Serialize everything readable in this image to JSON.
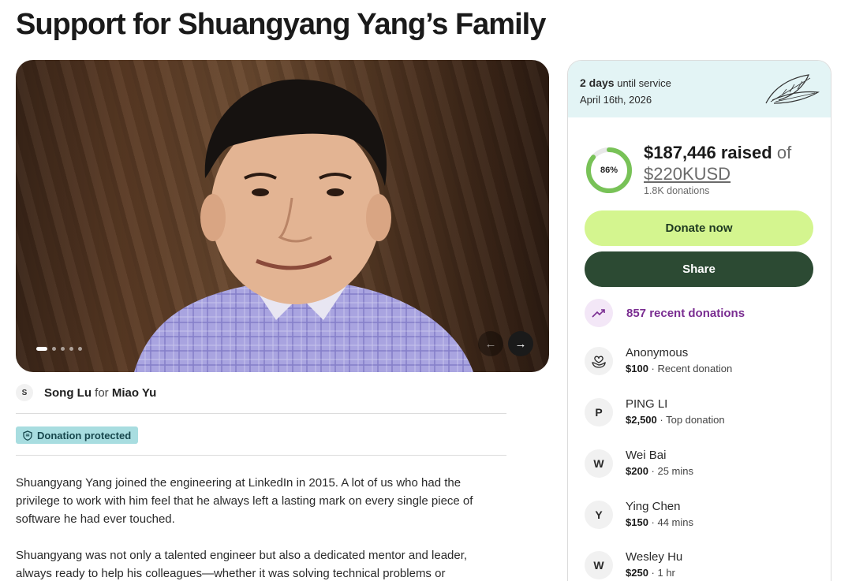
{
  "page": {
    "title": "Support for Shuangyang Yang’s Family"
  },
  "carousel": {
    "slide_count": 5,
    "active_index": 0,
    "prev_icon": "arrow-left-icon",
    "next_icon": "arrow-right-icon"
  },
  "organizer": {
    "initial": "S",
    "name": "Song Lu",
    "for_word": "for",
    "beneficiary": "Miao Yu"
  },
  "badge": {
    "label": "Donation protected",
    "icon": "shield-icon"
  },
  "story": {
    "paragraphs": [
      "Shuangyang Yang joined the engineering at LinkedIn in 2015. A lot of us who had the privilege to work with him feel that he always left a lasting mark on every single piece of software he had ever touched.",
      "Shuangyang was not only a talented engineer but also a dedicated mentor and leader, always ready to help his colleagues—whether it was solving technical problems or"
    ]
  },
  "sidebar": {
    "countdown": {
      "days": "2 days",
      "suffix": "until service",
      "date": "April 16th, 2026"
    },
    "progress": {
      "percent_label": "86%",
      "fraction": 0.86
    },
    "raised": {
      "amount": "$187,446 raised",
      "of": "of",
      "goal": "$220KUSD",
      "donations": "1.8K donations"
    },
    "donate_label": "Donate now",
    "share_label": "Share",
    "recent_label": "857 recent donations",
    "donors": [
      {
        "initial": "",
        "icon": "hand-heart-icon",
        "name": "Anonymous",
        "amount": "$100",
        "note": "· Recent donation"
      },
      {
        "initial": "P",
        "name": "PING LI",
        "amount": "$2,500",
        "note": "· Top donation"
      },
      {
        "initial": "W",
        "name": "Wei Bai",
        "amount": "$200",
        "note": "· 25 mins"
      },
      {
        "initial": "Y",
        "name": "Ying Chen",
        "amount": "$150",
        "note": "· 44 mins"
      },
      {
        "initial": "W",
        "name": "Wesley Hu",
        "amount": "$250",
        "note": "· 1 hr"
      }
    ]
  },
  "colors": {
    "donate": "#d4f58f",
    "share": "#2c4a33",
    "accent_purple": "#7a2d91",
    "progress": "#78c257",
    "card_header": "#e3f4f5"
  }
}
